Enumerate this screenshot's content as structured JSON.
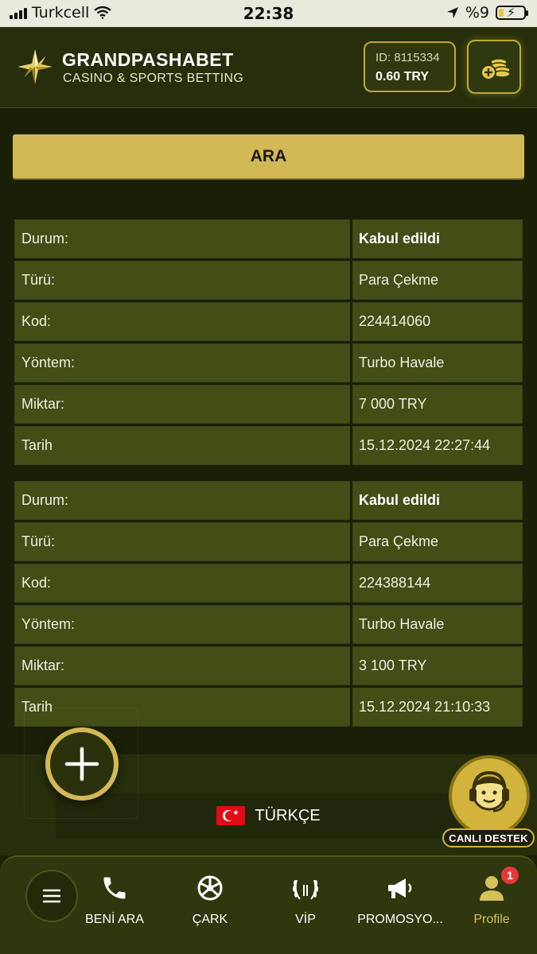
{
  "status_bar": {
    "carrier": "Turkcell",
    "time": "22:38",
    "battery": "%9"
  },
  "header": {
    "brand_name": "GRANDPASHABET",
    "brand_tagline": "CASINO & SPORTS BETTING",
    "user_id": "ID: 8115334",
    "balance": "0.60 TRY",
    "icons": {
      "logo": "star-logo-icon",
      "deposit": "coins-plus-icon"
    }
  },
  "search_button": "ARA",
  "transactions": [
    {
      "rows": [
        {
          "label": "Durum:",
          "value": "Kabul edildi",
          "bold": true
        },
        {
          "label": "Türü:",
          "value": "Para Çekme"
        },
        {
          "label": "Kod:",
          "value": "224414060"
        },
        {
          "label": "Yöntem:",
          "value": "Turbo Havale"
        },
        {
          "label": "Miktar:",
          "value": "7 000 TRY"
        },
        {
          "label": "Tarih",
          "value": "15.12.2024 22:27:44"
        }
      ]
    },
    {
      "rows": [
        {
          "label": "Durum:",
          "value": "Kabul edildi",
          "bold": true
        },
        {
          "label": "Türü:",
          "value": "Para Çekme"
        },
        {
          "label": "Kod:",
          "value": "224388144"
        },
        {
          "label": "Yöntem:",
          "value": "Turbo Havale"
        },
        {
          "label": "Miktar:",
          "value": "3 100 TRY"
        },
        {
          "label": "Tarih",
          "value": "15.12.2024 21:10:33"
        }
      ]
    }
  ],
  "language": {
    "label": "TÜRKÇE",
    "icon": "turkey-flag-icon"
  },
  "live_support": {
    "label": "CANLI DESTEK",
    "icon": "headset-agent-icon"
  },
  "floating_button": {
    "icon": "plus-icon"
  },
  "bottom_nav": {
    "menu_icon": "hamburger-icon",
    "items": [
      {
        "label": "BENİ ARA",
        "icon": "phone-icon"
      },
      {
        "label": "ÇARK",
        "icon": "wheel-icon"
      },
      {
        "label": "VİP",
        "icon": "laurel-icon"
      },
      {
        "label": "PROMOSYO...",
        "icon": "megaphone-icon"
      },
      {
        "label": "Profile",
        "icon": "user-icon",
        "badge": "1"
      }
    ]
  },
  "colors": {
    "accent_gold": "#d2b956",
    "panel_olive": "#434d16",
    "background": "#1a1f08",
    "badge_red": "#e53935"
  }
}
